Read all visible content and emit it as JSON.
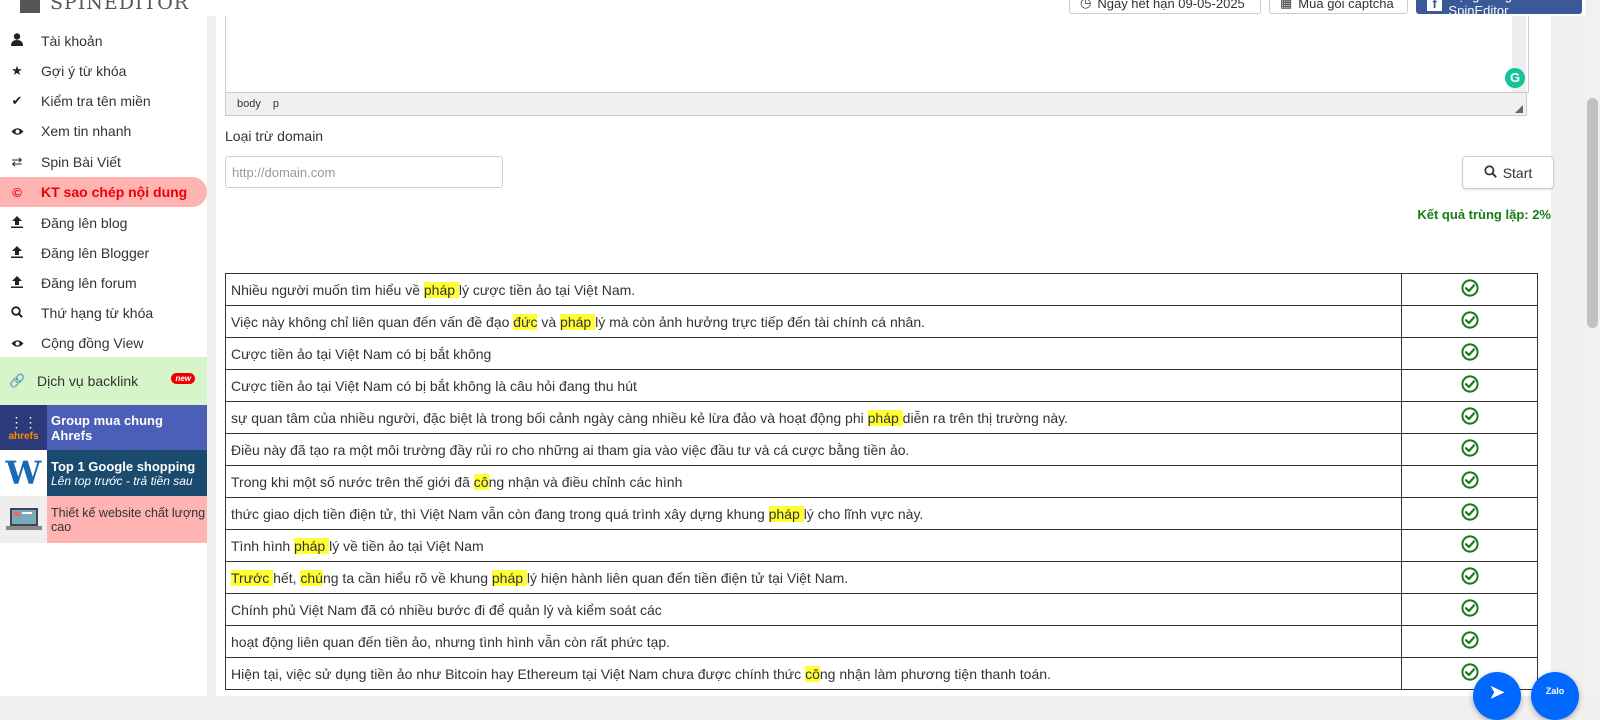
{
  "header": {
    "logo_text": "SPINEDITOR",
    "expiry_label": "Ngày hết hạn 09-05-2025",
    "captcha_label": "Mua gói captcha",
    "community_label": "Cộng đồng SpinEditor"
  },
  "sidebar": {
    "items": [
      {
        "label": "Tài khoản",
        "icon": "user-icon"
      },
      {
        "label": "Gợi ý từ khóa",
        "icon": "star-icon"
      },
      {
        "label": "Kiểm tra tên miền",
        "icon": "check-icon"
      },
      {
        "label": "Xem tin nhanh",
        "icon": "eye-icon"
      },
      {
        "label": "Spin Bài Viết",
        "icon": "shuffle-icon"
      },
      {
        "label": "KT sao chép nội dung",
        "icon": "copyright-icon"
      },
      {
        "label": "Đăng lên blog",
        "icon": "upload-icon"
      },
      {
        "label": "Đăng lên Blogger",
        "icon": "upload-icon"
      },
      {
        "label": "Đăng lên forum",
        "icon": "upload-icon"
      },
      {
        "label": "Thứ hạng từ khóa",
        "icon": "search-icon"
      },
      {
        "label": "Cộng đồng View",
        "icon": "eye-icon"
      }
    ],
    "backlink": {
      "label": "Dịch vụ backlink",
      "badge": "new",
      "icon": "link-icon"
    },
    "promos": [
      {
        "label": "Group mua chung Ahrefs",
        "logo_text": "ahrefs",
        "bg": "#4a5fb5"
      },
      {
        "label": "Top 1 Google shopping",
        "sublabel": "Lên top trước - trả tiền sau",
        "bg": "#1a4a6e"
      },
      {
        "label": "Thiết kế website chất lượng cao",
        "bg": "#ffb3b3"
      }
    ]
  },
  "editor": {
    "status_tags": [
      "body",
      "p"
    ]
  },
  "form": {
    "exclude_label": "Loại trừ domain",
    "domain_placeholder": "http://domain.com",
    "start_label": "Start"
  },
  "result": {
    "label": "Kết quả trùng lặp: 2%"
  },
  "rows": [
    [
      {
        "t": "Nhiều người muốn tìm hiểu về "
      },
      {
        "t": "pháp ",
        "h": true
      },
      {
        "t": "lý cược tiền ảo tại Việt Nam."
      }
    ],
    [
      {
        "t": "Việc này không chỉ liên quan đến vấn đề đạo "
      },
      {
        "t": "đức",
        "h": true
      },
      {
        "t": " và "
      },
      {
        "t": "pháp ",
        "h": true
      },
      {
        "t": "lý mà còn ảnh hưởng trực tiếp đến tài chính cá nhân."
      }
    ],
    [
      {
        "t": "Cược tiền ảo tại Việt Nam có bị bắt không"
      }
    ],
    [
      {
        "t": "Cược tiền ảo tại Việt Nam có bị bắt không là câu hỏi đang thu hút"
      }
    ],
    [
      {
        "t": "sự quan tâm của nhiều người, đặc biệt là trong bối cảnh ngày càng nhiều kẻ lừa đảo và hoạt động phi "
      },
      {
        "t": "pháp ",
        "h": true
      },
      {
        "t": "diễn ra trên thị trường này."
      }
    ],
    [
      {
        "t": "Điều này đã tạo ra một môi trường đầy rủi ro cho những ai tham gia vào việc đầu tư và cá cược bằng tiền ảo."
      }
    ],
    [
      {
        "t": "Trong khi một số nước trên thế giới đã "
      },
      {
        "t": "cô",
        "h": true
      },
      {
        "t": "ng nhận và điều chỉnh các hình"
      }
    ],
    [
      {
        "t": "thức giao dịch tiền điện tử, thì Việt Nam vẫn còn đang trong quá trình xây dựng khung "
      },
      {
        "t": "pháp ",
        "h": true
      },
      {
        "t": "lý cho lĩnh vực này."
      }
    ],
    [
      {
        "t": "Tình hình "
      },
      {
        "t": "pháp ",
        "h": true
      },
      {
        "t": "lý về tiền ảo tại Việt Nam"
      }
    ],
    [
      {
        "t": "Trước ",
        "h": true
      },
      {
        "t": "hết, "
      },
      {
        "t": "chú",
        "h": true
      },
      {
        "t": "ng ta cần hiểu rõ về khung "
      },
      {
        "t": "pháp ",
        "h": true
      },
      {
        "t": "lý hiện hành liên quan đến tiền điện tử tại Việt Nam."
      }
    ],
    [
      {
        "t": "Chính phủ Việt Nam đã có nhiều bước đi để quản lý và kiểm soát các"
      }
    ],
    [
      {
        "t": "hoạt động liên quan đến tiền ảo, nhưng tình hình vẫn còn rất phức tạp."
      }
    ],
    [
      {
        "t": "Hiện tại, việc sử dụng tiền ảo như Bitcoin hay Ethereum tại Việt Nam chưa được chính thức "
      },
      {
        "t": "cô",
        "h": true
      },
      {
        "t": "ng nhận làm phương tiện thanh toán."
      }
    ]
  ],
  "colors": {
    "check": "#1a7a1a",
    "highlight": "#ffff33",
    "active_nav": "#ffb3b3"
  },
  "floating": {
    "zalo_label": "Zalo"
  }
}
